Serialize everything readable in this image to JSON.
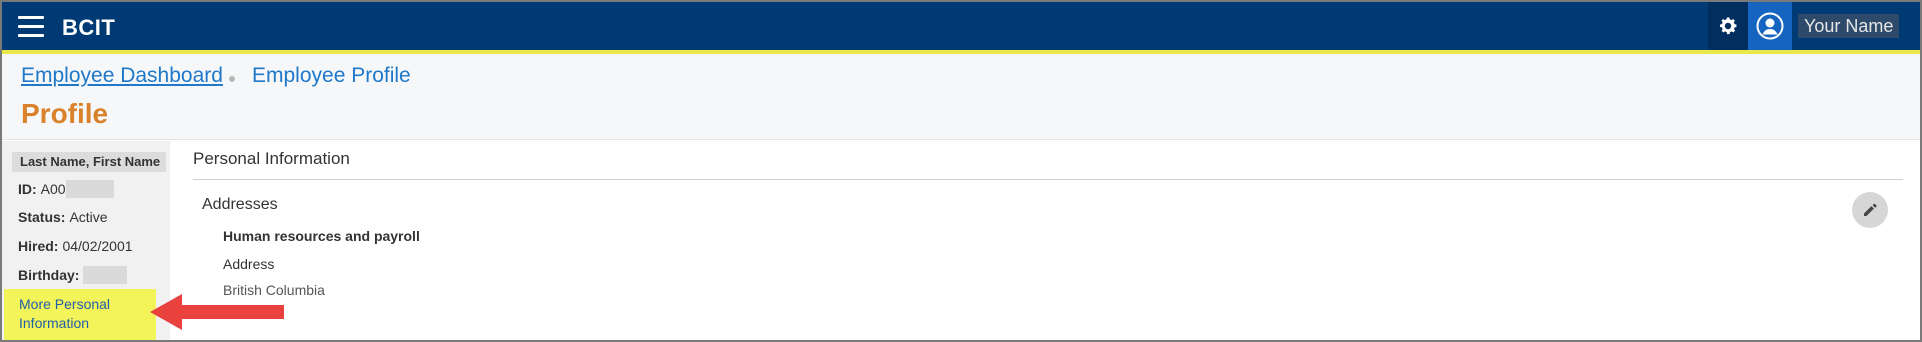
{
  "topbar": {
    "brand": "BCIT",
    "user_name": "Your Name"
  },
  "breadcrumb": {
    "items": [
      "Employee Dashboard",
      "Employee Profile"
    ]
  },
  "page": {
    "title": "Profile"
  },
  "sidebar": {
    "name": "Last Name, First Name",
    "id_label": "ID:",
    "id_value": "A00",
    "status_label": "Status:",
    "status_value": "Active",
    "hired_label": "Hired:",
    "hired_value": "04/02/2001",
    "birthday_label": "Birthday:",
    "more_link": "More Personal Information"
  },
  "main": {
    "section_title": "Personal Information",
    "addresses_title": "Addresses",
    "address_group": "Human resources and payroll",
    "address_label": "Address",
    "address_value": "British Columbia"
  },
  "colors": {
    "topbar": "#003a74",
    "accent_yellow": "#e8e84a",
    "title_orange": "#d9822b",
    "link_blue": "#1f78c8",
    "highlight_yellow": "#f3f35a",
    "annotation_red": "#e8413e"
  },
  "icons": {
    "menu": "hamburger-icon",
    "settings": "gear-icon",
    "user": "user-avatar-icon",
    "edit": "pencil-icon",
    "annotation": "arrow-left-icon"
  }
}
